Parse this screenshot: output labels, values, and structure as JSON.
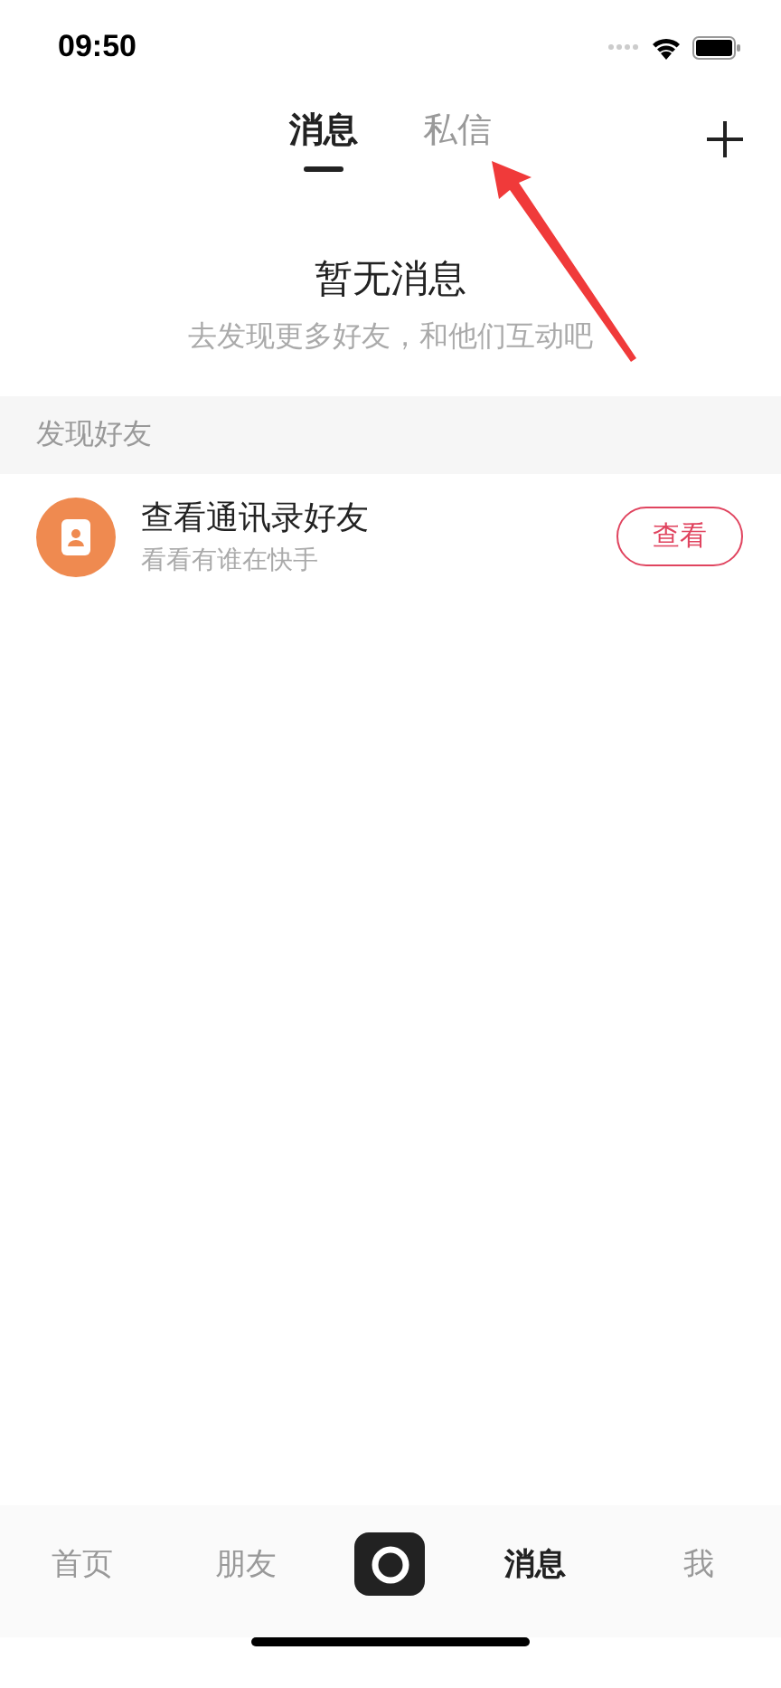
{
  "status_bar": {
    "time": "09:50"
  },
  "tabs": [
    {
      "label": "消息",
      "selected": true
    },
    {
      "label": "私信",
      "selected": false
    }
  ],
  "empty_state": {
    "title": "暂无消息",
    "subtitle": "去发现更多好友，和他们互动吧"
  },
  "section": {
    "title": "发现好友"
  },
  "suggestion": {
    "title": "查看通讯录好友",
    "subtitle": "看看有谁在快手",
    "button": "查看"
  },
  "bottom_nav": [
    {
      "kind": "text",
      "label": "首页",
      "selected": false
    },
    {
      "kind": "text",
      "label": "朋友",
      "selected": false
    },
    {
      "kind": "camera",
      "selected": false
    },
    {
      "kind": "text",
      "label": "消息",
      "selected": true
    },
    {
      "kind": "text",
      "label": "我",
      "selected": false
    }
  ]
}
